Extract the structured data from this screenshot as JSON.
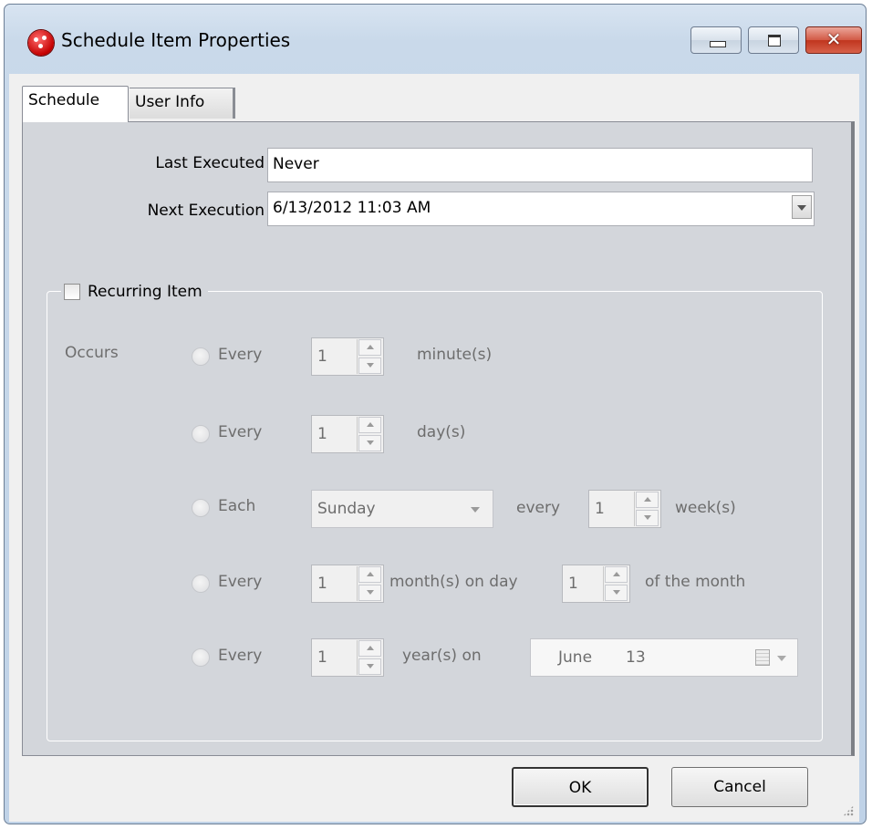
{
  "window": {
    "title": "Schedule Item Properties",
    "controls": {
      "minimize": "",
      "maximize": "",
      "close": "✕"
    }
  },
  "tabs": [
    {
      "label": "Schedule",
      "active": true
    },
    {
      "label": "User Info",
      "active": false
    }
  ],
  "schedule": {
    "last_executed_label": "Last Executed",
    "last_executed_value": "Never",
    "next_execution_label": "Next Execution",
    "next_execution_value": "6/13/2012 11:03 AM",
    "recurring_label": "Recurring Item",
    "recurring_checked": false,
    "occurs_label": "Occurs",
    "rows": {
      "minutes": {
        "prefix": "Every",
        "value": "1",
        "suffix": "minute(s)"
      },
      "days": {
        "prefix": "Every",
        "value": "1",
        "suffix": "day(s)"
      },
      "weeks": {
        "prefix": "Each",
        "day": "Sunday",
        "every": "every",
        "value": "1",
        "suffix": "week(s)"
      },
      "months": {
        "prefix": "Every",
        "value": "1",
        "mid": "month(s) on day",
        "day_value": "1",
        "suffix": "of the month"
      },
      "years": {
        "prefix": "Every",
        "value": "1",
        "mid": "year(s) on",
        "month": "June",
        "day": "13"
      }
    }
  },
  "buttons": {
    "ok": "OK",
    "cancel": "Cancel"
  },
  "colors": {
    "title_bar": "#c9d9ea",
    "tab_page": "#d3d6db",
    "disabled_text": "#6d6d6d",
    "close_button": "#c0351e"
  }
}
